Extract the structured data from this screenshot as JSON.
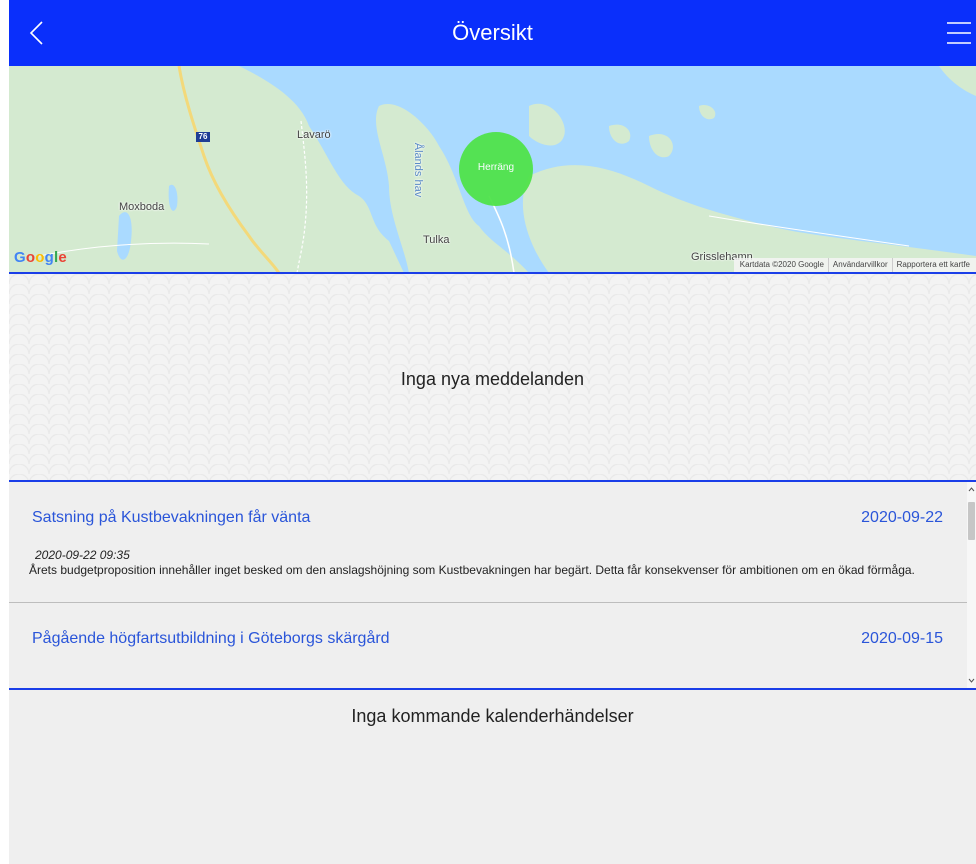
{
  "header": {
    "title": "Översikt",
    "back_icon": "chevron-left-icon",
    "menu_icon": "hamburger-menu-icon",
    "color": "#0a2ffb"
  },
  "map": {
    "places": [
      "Lavarö",
      "Moxboda",
      "Tulka",
      "Grisslehamn",
      "Ålands hav"
    ],
    "road_number": "76",
    "marker_label": "Herräng",
    "marker_color": "#50e34a",
    "google_logo": "Google",
    "attribution": [
      "Kartdata ©2020 Google",
      "Användarvillkor",
      "Rapportera ett kartfe"
    ]
  },
  "messages": {
    "empty_text": "Inga nya meddelanden"
  },
  "news": {
    "items": [
      {
        "title": "Satsning på Kustbevakningen får vänta",
        "date": "2020-09-22",
        "timestamp": "2020-09-22 09:35",
        "text": "Årets budgetproposition innehåller inget besked om den anslagshöjning som Kustbevakningen har begärt. Detta får konsekvenser för ambitionen om en ökad förmåga."
      },
      {
        "title": "Pågående högfartsutbildning i Göteborgs skärgård",
        "date": "2020-09-15"
      }
    ],
    "link_color": "#2a55d9"
  },
  "calendar": {
    "empty_text": "Inga kommande kalenderhändelser"
  }
}
